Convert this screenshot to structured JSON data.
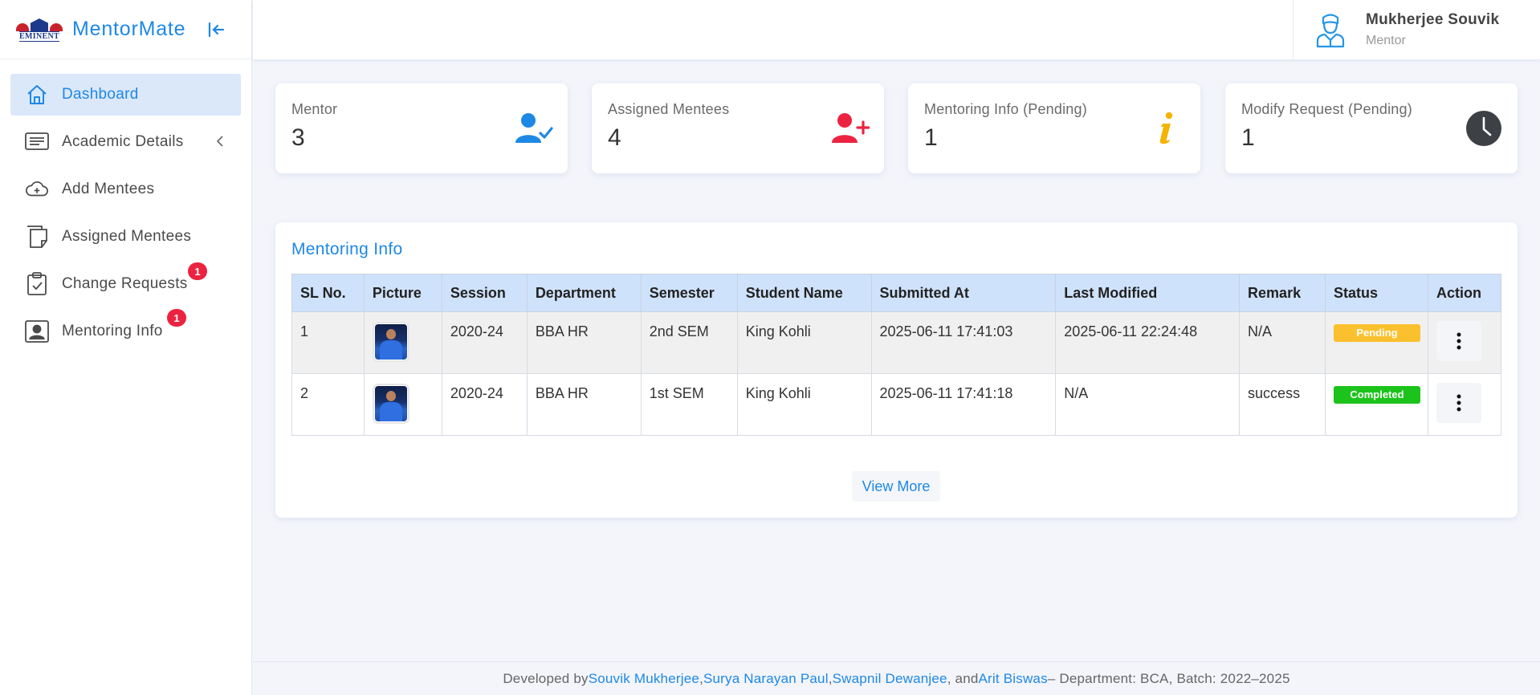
{
  "brand": {
    "name": "MentorMate",
    "logo_text": "EMINENT"
  },
  "sidebar": {
    "items": [
      {
        "label": "Dashboard",
        "icon": "home-icon"
      },
      {
        "label": "Academic Details",
        "icon": "list-icon"
      },
      {
        "label": "Add Mentees",
        "icon": "cloud-plus-icon"
      },
      {
        "label": "Assigned Mentees",
        "icon": "notes-icon"
      },
      {
        "label": "Change Requests",
        "icon": "clipboard-check-icon",
        "badge": "1"
      },
      {
        "label": "Mentoring Info",
        "icon": "user-card-icon",
        "badge": "1"
      }
    ]
  },
  "header": {
    "user_name": "Mukherjee Souvik",
    "user_role": "Mentor"
  },
  "cards": [
    {
      "label": "Mentor",
      "value": "3",
      "icon": "user-check-icon",
      "color": "#1e88e5"
    },
    {
      "label": "Assigned Mentees",
      "value": "4",
      "icon": "user-plus-icon",
      "color": "#ec2340"
    },
    {
      "label": "Mentoring Info (Pending)",
      "value": "1",
      "icon": "info-icon",
      "color": "#f4b400"
    },
    {
      "label": "Modify Request (Pending)",
      "value": "1",
      "icon": "clock-icon",
      "color": "#3d4146"
    }
  ],
  "panel": {
    "title": "Mentoring Info",
    "columns": [
      "SL No.",
      "Picture",
      "Session",
      "Department",
      "Semester",
      "Student Name",
      "Submitted At",
      "Last Modified",
      "Remark",
      "Status",
      "Action"
    ],
    "rows": [
      {
        "sl": "1",
        "session": "2020-24",
        "department": "BBA HR",
        "semester": "2nd SEM",
        "student": "King Kohli",
        "submitted": "2025-06-11 17:41:03",
        "modified": "2025-06-11 22:24:48",
        "remark": "N/A",
        "status": "Pending"
      },
      {
        "sl": "2",
        "session": "2020-24",
        "department": "BBA HR",
        "semester": "1st SEM",
        "student": "King Kohli",
        "submitted": "2025-06-11 17:41:18",
        "modified": "N/A",
        "remark": "success",
        "status": "Completed"
      }
    ],
    "view_more": "View More"
  },
  "footer": {
    "prefix": "Developed by ",
    "devs": [
      "Souvik Mukherjee",
      "Surya Narayan Paul",
      "Swapnil Dewanjee",
      "Arit Biswas"
    ],
    "sep1": ", ",
    "sep_and": ", and ",
    "suffix": " – Department: BCA, Batch: 2022–2025"
  }
}
